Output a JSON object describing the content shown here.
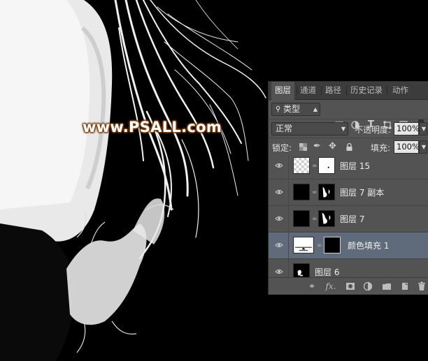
{
  "watermark": "www.PSALL.com",
  "panel": {
    "tabs": [
      "图层",
      "通道",
      "路径",
      "历史记录",
      "动作"
    ],
    "active_tab": "图层",
    "filter": {
      "label": "类型"
    },
    "blend_mode": "正常",
    "opacity_label": "不透明度:",
    "opacity_value": "100%",
    "lock_label": "锁定:",
    "fill_label": "填充:",
    "fill_value": "100%",
    "layers": [
      {
        "name": "图层 15"
      },
      {
        "name": "图层 7 副本"
      },
      {
        "name": "图层 7"
      },
      {
        "name": "颜色填充 1",
        "selected": true
      },
      {
        "name": "图层 6"
      }
    ]
  },
  "icons": {
    "filter": "search-icon",
    "eye": "eye-icon",
    "link": "chain-link-icon",
    "bottom": [
      "link-layers-icon",
      "fx-icon",
      "add-mask-icon",
      "adjustment-icon",
      "new-group-icon",
      "new-layer-icon",
      "trash-icon"
    ]
  },
  "colors": {
    "panel_bg": "#535353",
    "tab_bg": "#3c3c3c",
    "selected_row": "#5f6b7a",
    "watermark_outline": "#8a4a12"
  }
}
